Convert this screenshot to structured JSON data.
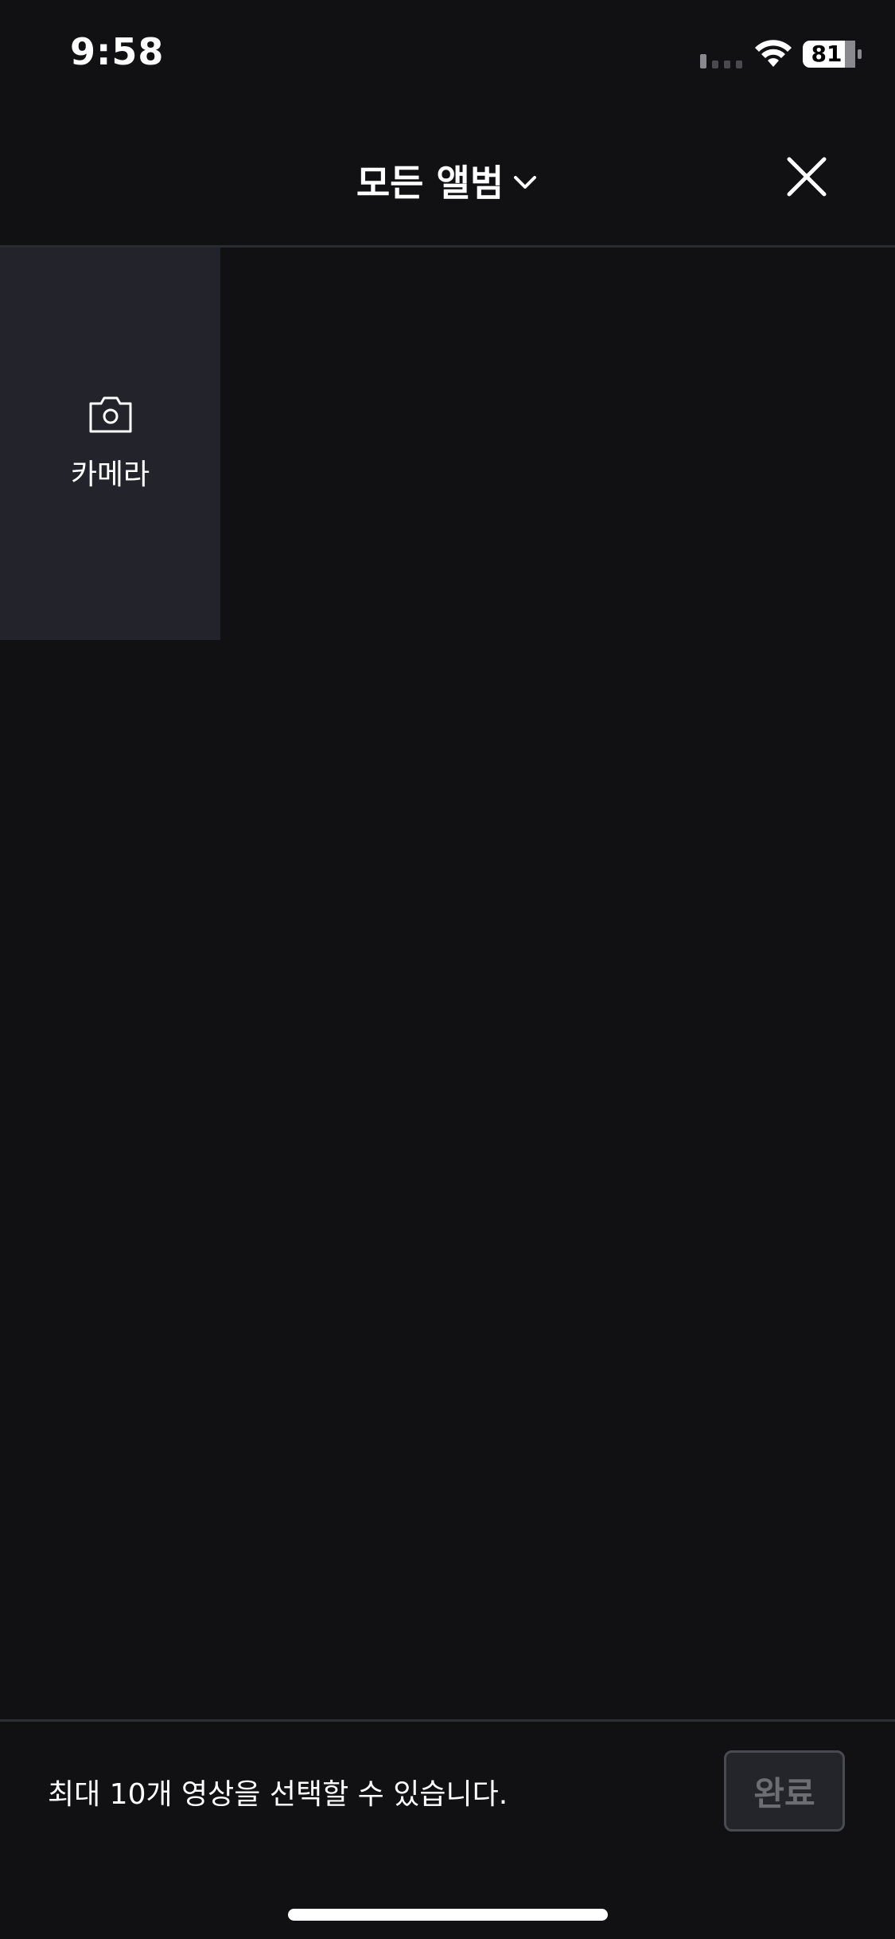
{
  "status_bar": {
    "time": "9:58",
    "battery": "81",
    "signal_icon": "cellular-signal-icon",
    "wifi_icon": "wifi-icon"
  },
  "header": {
    "album_title": "모든 앨범",
    "chevron_icon": "chevron-down-icon",
    "close_icon": "close-icon"
  },
  "grid": {
    "camera_tile": {
      "icon": "camera-icon",
      "label": "카메라"
    }
  },
  "footer": {
    "hint": "최대 10개 영상을 선택할 수 있습니다.",
    "done_label": "완료"
  },
  "colors": {
    "background": "#111113",
    "camera_tile": "#23242b",
    "done_button_bg": "#24252b",
    "done_button_text": "#6c6d73"
  }
}
